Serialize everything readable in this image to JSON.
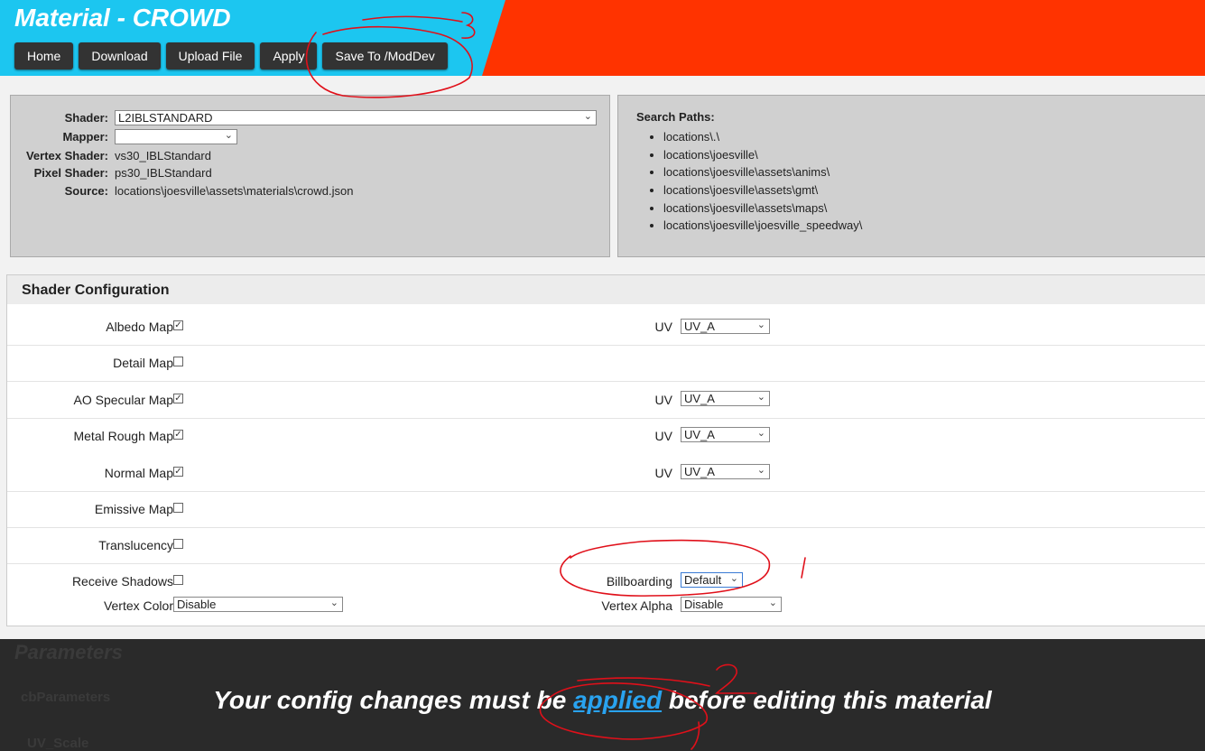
{
  "header": {
    "title": "Material - CROWD",
    "buttons": [
      "Home",
      "Download",
      "Upload File",
      "Apply",
      "Save To /ModDev"
    ]
  },
  "info": {
    "shader_label": "Shader:",
    "shader_value": "L2IBLSTANDARD",
    "mapper_label": "Mapper:",
    "mapper_value": "",
    "vertex_label": "Vertex Shader:",
    "vertex_value": "vs30_IBLStandard",
    "pixel_label": "Pixel Shader:",
    "pixel_value": "ps30_IBLStandard",
    "source_label": "Source:",
    "source_value": "locations\\joesville\\assets\\materials\\crowd.json"
  },
  "search_paths": {
    "title": "Search Paths:",
    "items": [
      "locations\\.\\",
      "locations\\joesville\\",
      "locations\\joesville\\assets\\anims\\",
      "locations\\joesville\\assets\\gmt\\",
      "locations\\joesville\\assets\\maps\\",
      "locations\\joesville\\joesville_speedway\\"
    ]
  },
  "config": {
    "title": "Shader Configuration",
    "rows": [
      {
        "label": "Albedo Map",
        "checked": true,
        "uv_label": "UV",
        "uv_value": "UV_A"
      },
      {
        "label": "Detail Map",
        "checked": false
      },
      {
        "label": "AO Specular Map",
        "checked": true,
        "uv_label": "UV",
        "uv_value": "UV_A"
      },
      {
        "label": "Metal Rough Map",
        "checked": true,
        "uv_label": "UV",
        "uv_value": "UV_A"
      },
      {
        "label": "Normal Map",
        "checked": true,
        "uv_label": "UV",
        "uv_value": "UV_A"
      },
      {
        "label": "Emissive Map",
        "checked": false
      },
      {
        "label": "Translucency",
        "checked": false
      },
      {
        "label": "Receive Shadows",
        "checked": false
      }
    ],
    "billboarding_label": "Billboarding",
    "billboarding_value": "Default",
    "vertex_color_label": "Vertex Color",
    "vertex_color_value": "Disable",
    "vertex_alpha_label": "Vertex Alpha",
    "vertex_alpha_value": "Disable"
  },
  "background": {
    "parameters_heading": "Parameters",
    "cb_parameters": "cbParameters",
    "uv_scale": "UV_Scale"
  },
  "banner": {
    "before": "Your config changes must be ",
    "link": "applied",
    "after": " before editing this material"
  },
  "annotations": {
    "mark_1": "1",
    "mark_2": "2",
    "mark_3": "3",
    "color": "#e0101a"
  },
  "colors": {
    "header_cyan": "#1cc6f0",
    "header_red": "#ff3300",
    "button_bg": "#333333",
    "link_blue": "#29a3f0"
  }
}
